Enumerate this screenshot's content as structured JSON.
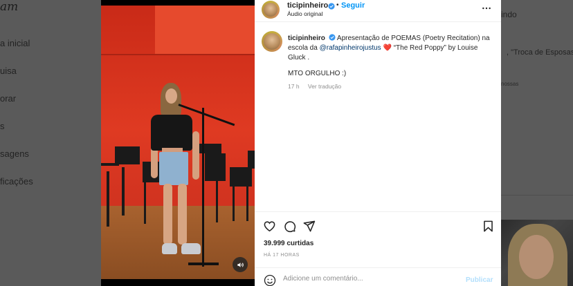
{
  "background": {
    "logo": "am",
    "nav": [
      "a inicial",
      "uisa",
      "orar",
      "s",
      "sagens",
      "ficações"
    ],
    "right_title": "indo",
    "right_suggestion": ", \"Troca de Esposas\", \"",
    "right_small": "nossas"
  },
  "post": {
    "header": {
      "username": "ticipinheiro",
      "follow_label": "Seguir",
      "separator": "•",
      "audio": "Áudio original",
      "more_icon": "more-horizontal-icon"
    },
    "caption": {
      "username": "ticipinheiro",
      "text_before_mention": " Apresentação de POEMAS (Poetry Recitation) na escola da ",
      "mention": "@rafapinheirojustus",
      "heart": "❤️",
      "text_after_mention": " “The Red Poppy” by Louise Gluck .",
      "line2": "MTO ORGULHO :)",
      "time": "17 h",
      "translate": "Ver tradução"
    },
    "actions": {
      "like_icon": "heart-icon",
      "comment_icon": "comment-icon",
      "share_icon": "share-icon",
      "save_icon": "bookmark-icon"
    },
    "likes": "39.999 curtidas",
    "timestamp": "HÁ 17 HORAS",
    "comment": {
      "placeholder": "Adicione um comentário...",
      "publish_label": "Publicar"
    }
  },
  "colors": {
    "accent": "#0095f6",
    "verified": "#3897f0",
    "publish_disabled": "#b2dffc"
  }
}
